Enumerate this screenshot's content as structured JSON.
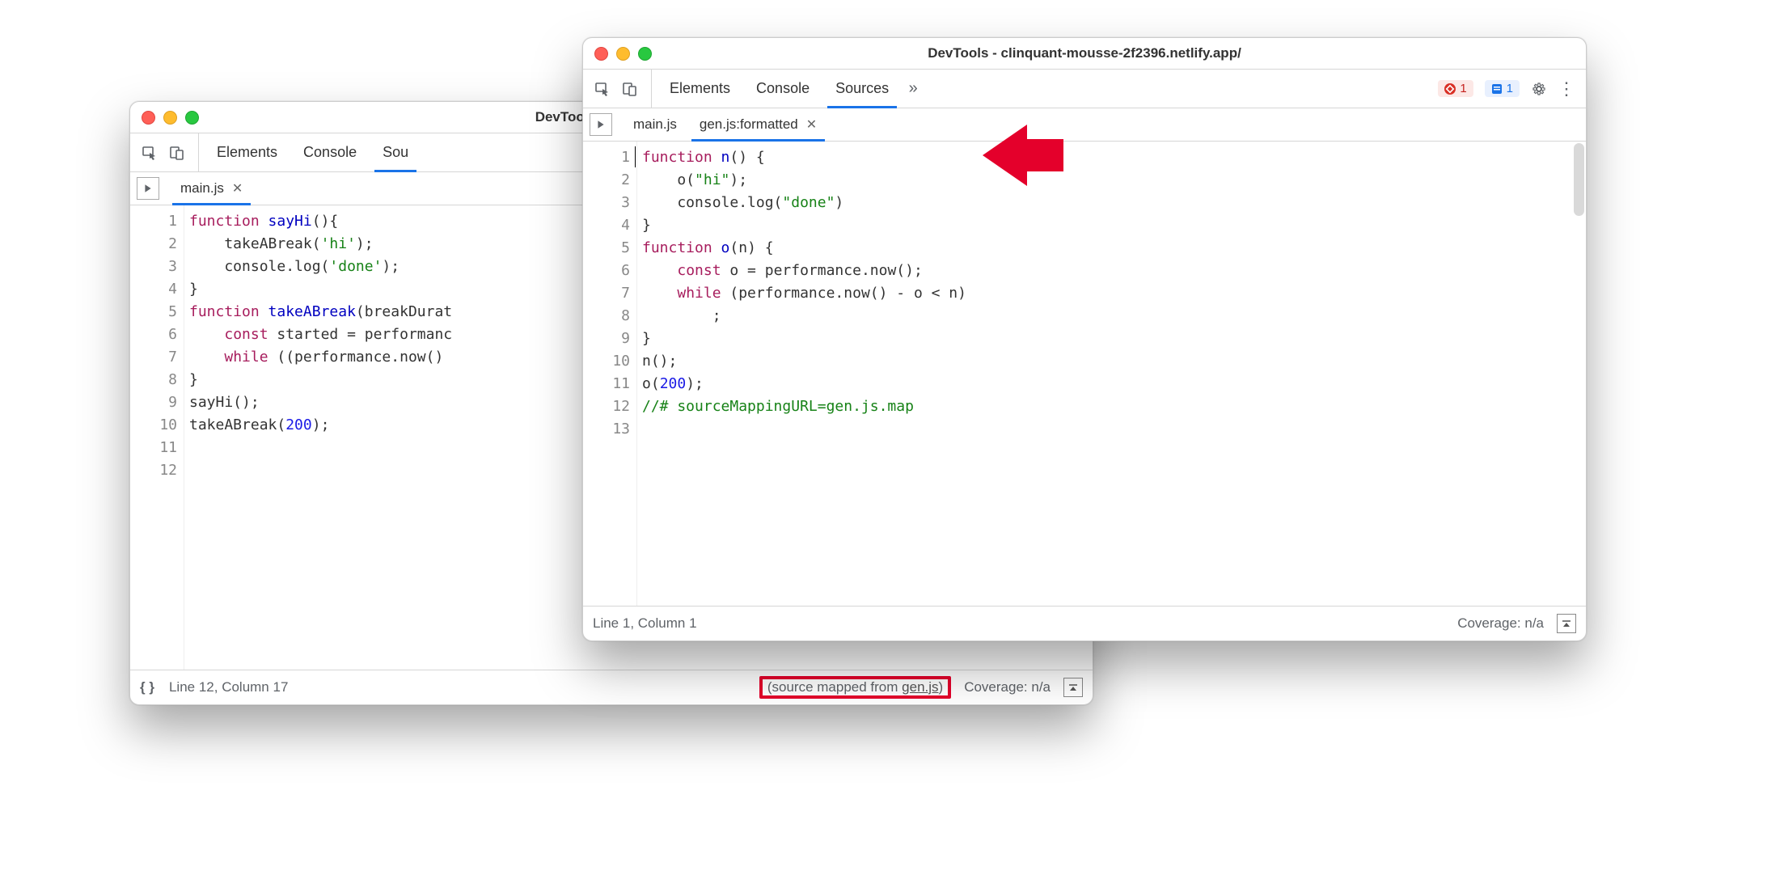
{
  "w1": {
    "title": "DevTools - clinquant-…",
    "panels": {
      "elements": "Elements",
      "console": "Console",
      "sources": "Sou"
    },
    "filetab": "main.js",
    "gutter": [
      "1",
      "2",
      "3",
      "4",
      "5",
      "6",
      "7",
      "8",
      "9",
      "10",
      "11",
      "12"
    ],
    "status": {
      "pos": "Line 12, Column 17",
      "mapped_prefix": "(source mapped from ",
      "mapped_link": "gen.js",
      "mapped_suffix": ")",
      "coverage": "Coverage: n/a"
    }
  },
  "w2": {
    "title": "DevTools - clinquant-mousse-2f2396.netlify.app/",
    "panels": {
      "elements": "Elements",
      "console": "Console",
      "sources": "Sources"
    },
    "errcount": "1",
    "infocount": "1",
    "filetab_inactive": "main.js",
    "filetab_active": "gen.js:formatted",
    "gutter": [
      "1",
      "2",
      "3",
      "4",
      "5",
      "6",
      "7",
      "8",
      "9",
      "10",
      "11",
      "12",
      "13"
    ],
    "status": {
      "pos": "Line 1, Column 1",
      "coverage": "Coverage: n/a"
    }
  },
  "code1": {
    "l1a": "function",
    "l1b": " ",
    "l1c": "sayHi",
    "l1d": "(){",
    "l2a": "    takeABreak(",
    "l2b": "'hi'",
    "l2c": ");",
    "l3a": "    console.log(",
    "l3b": "'done'",
    "l3c": ");",
    "l4": "}",
    "l5": "",
    "l6a": "function",
    "l6b": " ",
    "l6c": "takeABreak",
    "l6d": "(breakDurat",
    "l7a": "    ",
    "l7b": "const",
    "l7c": " started = performanc",
    "l8a": "    ",
    "l8b": "while",
    "l8c": " ((performance.now() ",
    "l9": "}",
    "l10": "",
    "l11": "sayHi();",
    "l12a": "takeABreak(",
    "l12b": "200",
    "l12c": ");"
  },
  "code2": {
    "l1a": "function",
    "l1b": " ",
    "l1c": "n",
    "l1d": "() {",
    "l2a": "    o(",
    "l2b": "\"hi\"",
    "l2c": ");",
    "l3a": "    console.log(",
    "l3b": "\"done\"",
    "l3c": ")",
    "l4": "}",
    "l5a": "function",
    "l5b": " ",
    "l5c": "o",
    "l5d": "(n) {",
    "l6a": "    ",
    "l6b": "const",
    "l6c": " o = performance.now();",
    "l7a": "    ",
    "l7b": "while",
    "l7c": " (performance.now() - o < n)",
    "l8": "        ;",
    "l9": "}",
    "l10": "n();",
    "l11a": "o(",
    "l11b": "200",
    "l11c": ");",
    "l12": "//# sourceMappingURL=gen.js.map",
    "l13": ""
  }
}
